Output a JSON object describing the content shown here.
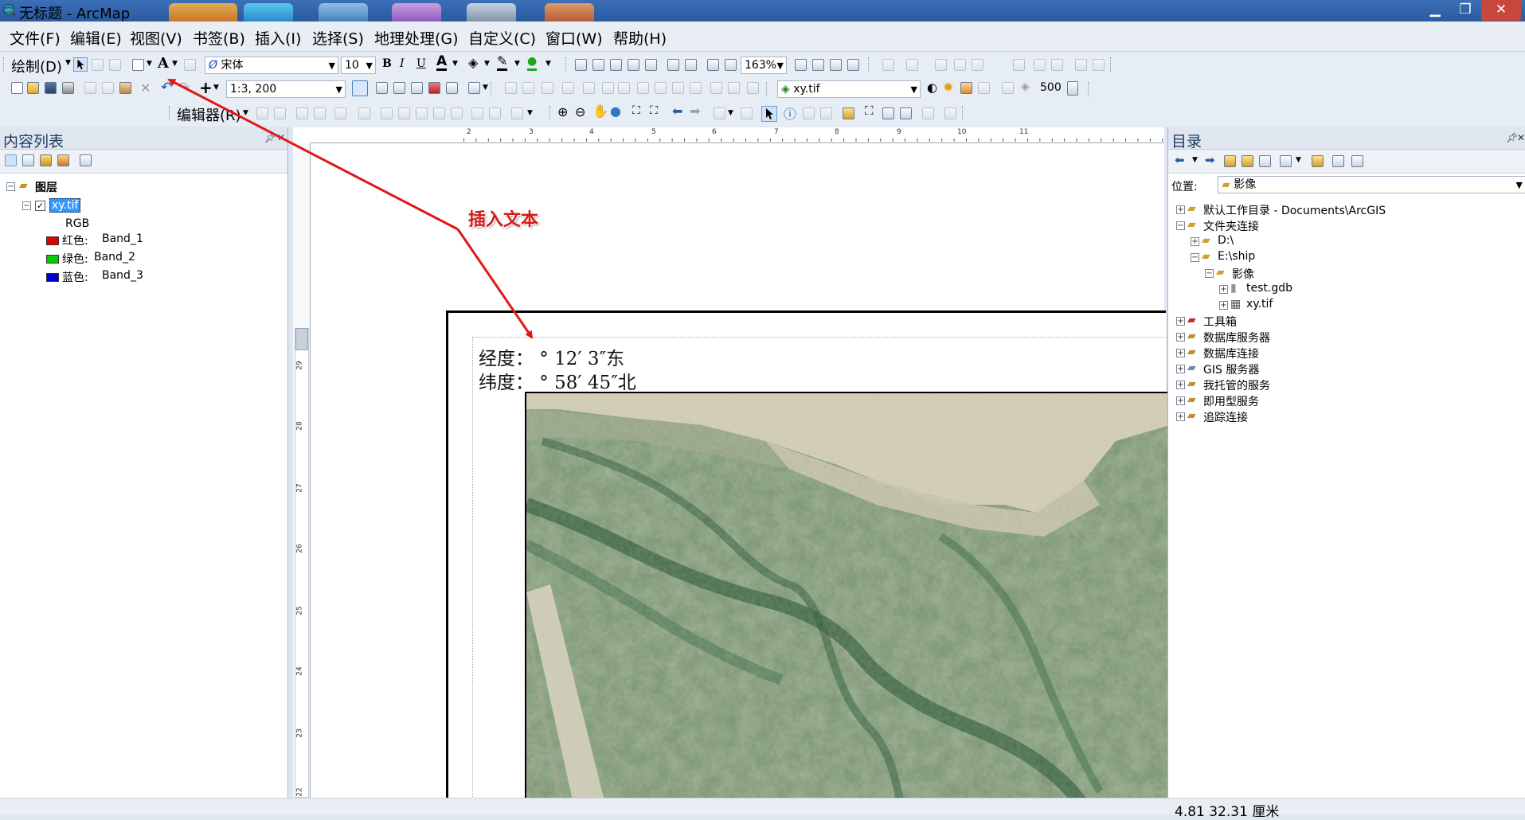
{
  "window": {
    "title": "无标题 - ArcMap",
    "minimize": "▁",
    "maximize": "❐",
    "close": "✕"
  },
  "menu": [
    "文件(F)",
    "编辑(E)",
    "视图(V)",
    "书签(B)",
    "插入(I)",
    "选择(S)",
    "地理处理(G)",
    "自定义(C)",
    "窗口(W)",
    "帮助(H)"
  ],
  "draw_toolbar": {
    "draw_label": "绘制(D)",
    "font": "宋体",
    "font_size": "10",
    "bold": "B",
    "italic": "I",
    "underline": "U",
    "zoom_percent": "163%"
  },
  "standard_toolbar": {
    "scale": "1:3, 200",
    "layer": "xy.tif",
    "value": "500"
  },
  "editor_toolbar": {
    "label": "编辑器(R)"
  },
  "toc": {
    "title": "内容列表",
    "layers_label": "图层",
    "layer_name": "xy.tif",
    "rgb_label": "RGB",
    "bands": [
      {
        "label": "红色:",
        "band": "Band_1",
        "color": "#e00000"
      },
      {
        "label": "绿色:",
        "band": "Band_2",
        "color": "#00d000"
      },
      {
        "label": "蓝色:",
        "band": "Band_3",
        "color": "#0000cc"
      }
    ]
  },
  "layout": {
    "ruler_numbers": [
      "2",
      "3",
      "4",
      "5",
      "6",
      "7",
      "8",
      "9",
      "10",
      "11"
    ],
    "vruler_numbers": [
      "29",
      "28",
      "27",
      "26",
      "25",
      "24",
      "23",
      "22"
    ],
    "longitude_text": "经度：  °  12′ 3″东",
    "latitude_text": "纬度： ° 58′ 45″北",
    "annotation": "插入文本"
  },
  "catalog": {
    "title": "目录",
    "location_label": "位置:",
    "location_value": "影像",
    "tree": [
      {
        "label": "默认工作目录 - Documents\\ArcGIS",
        "icon": "home-folder-icon"
      },
      {
        "label": "文件夹连接",
        "icon": "folder-connections-icon"
      },
      {
        "label": "D:\\",
        "icon": "folder-icon"
      },
      {
        "label": "E:\\ship",
        "icon": "folder-icon"
      },
      {
        "label": "影像",
        "icon": "folder-open-icon"
      },
      {
        "label": "test.gdb",
        "icon": "geodatabase-icon"
      },
      {
        "label": "xy.tif",
        "icon": "raster-icon"
      },
      {
        "label": "工具箱",
        "icon": "toolbox-icon"
      },
      {
        "label": "数据库服务器",
        "icon": "database-server-icon"
      },
      {
        "label": "数据库连接",
        "icon": "database-connection-icon"
      },
      {
        "label": "GIS 服务器",
        "icon": "gis-server-icon"
      },
      {
        "label": "我托管的服务",
        "icon": "hosted-services-icon"
      },
      {
        "label": "即用型服务",
        "icon": "ready-services-icon"
      },
      {
        "label": "追踪连接",
        "icon": "tracking-connection-icon"
      }
    ]
  },
  "status": {
    "coords": "4.81  32.31 厘米"
  },
  "colors": {
    "accent": "#3b6fb6",
    "arrow": "#e01818",
    "highlight": "#3399ff"
  }
}
